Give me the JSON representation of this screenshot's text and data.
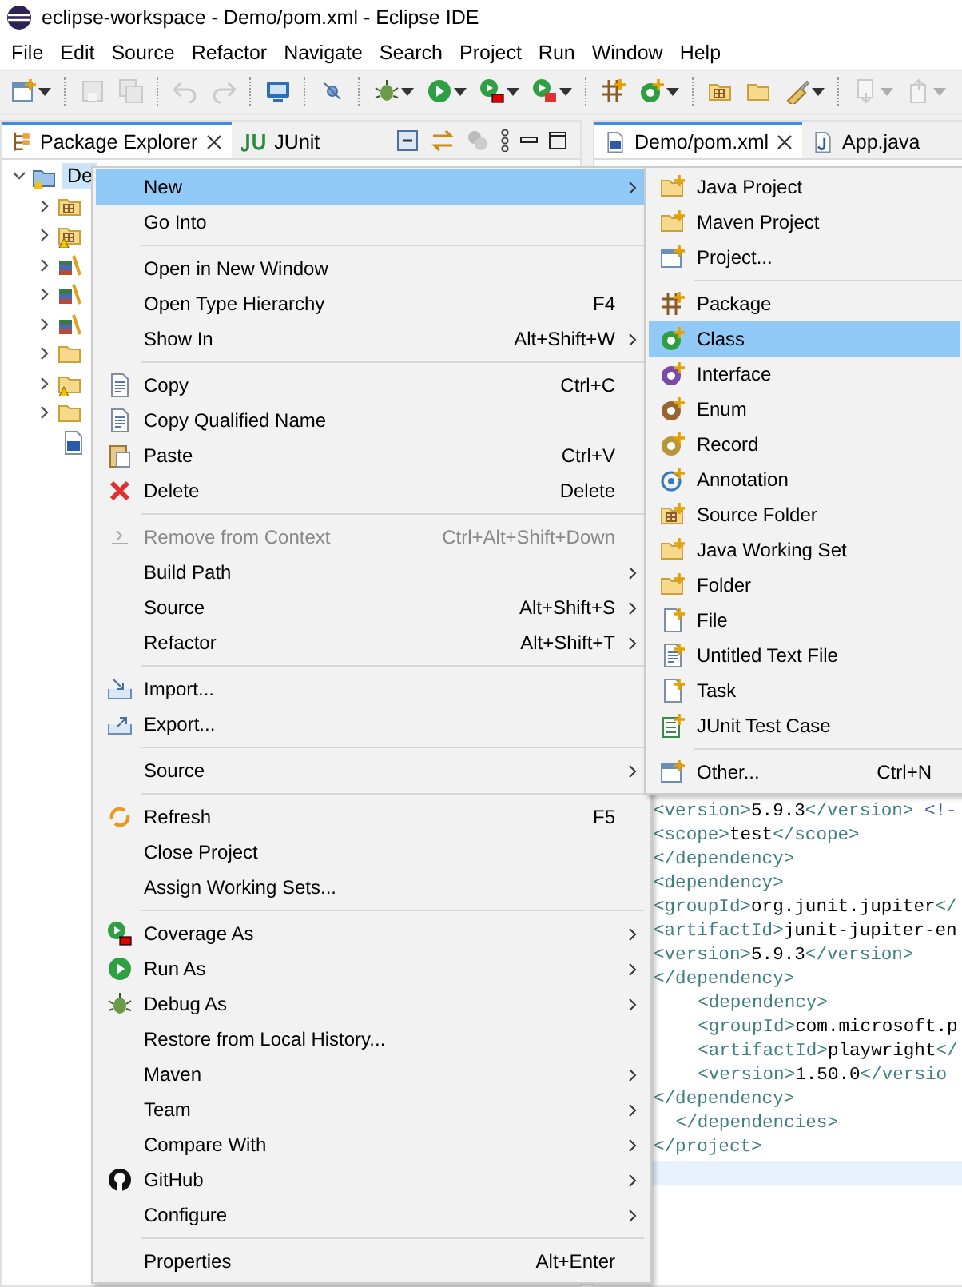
{
  "window": {
    "title": "eclipse-workspace - Demo/pom.xml - Eclipse IDE"
  },
  "menu_bar": [
    {
      "label": "File"
    },
    {
      "label": "Edit"
    },
    {
      "label": "Source"
    },
    {
      "label": "Refactor"
    },
    {
      "label": "Navigate"
    },
    {
      "label": "Search"
    },
    {
      "label": "Project"
    },
    {
      "label": "Run"
    },
    {
      "label": "Window"
    },
    {
      "label": "Help"
    }
  ],
  "toolbar": [
    {
      "disabled": false,
      "dropdown": true
    },
    {
      "disabled": true,
      "dropdown": false
    },
    {
      "disabled": true,
      "dropdown": false
    },
    {
      "disabled": true,
      "dropdown": false
    },
    {
      "disabled": true,
      "dropdown": false
    },
    {
      "disabled": false,
      "dropdown": false
    },
    {
      "disabled": false,
      "dropdown": false
    },
    {
      "disabled": false,
      "dropdown": true
    },
    {
      "disabled": false,
      "dropdown": true
    },
    {
      "disabled": false,
      "dropdown": true
    },
    {
      "disabled": false,
      "dropdown": true
    },
    {
      "disabled": false,
      "dropdown": false
    },
    {
      "disabled": false,
      "dropdown": true
    },
    {
      "disabled": false,
      "dropdown": false
    },
    {
      "disabled": false,
      "dropdown": false
    },
    {
      "disabled": false,
      "dropdown": true
    },
    {
      "disabled": true,
      "dropdown": true
    },
    {
      "disabled": true,
      "dropdown": true
    }
  ],
  "view_tabs": [
    {
      "label": "Package Explorer",
      "selected": true,
      "closable": true
    },
    {
      "label": "JUnit",
      "selected": false,
      "closable": false
    }
  ],
  "editor_tabs": [
    {
      "label": "Demo/pom.xml",
      "selected": true,
      "closable": true
    },
    {
      "label": "App.java",
      "selected": false,
      "closable": false
    }
  ],
  "tree": [
    {
      "label": "De",
      "expanded": true,
      "selected": true,
      "children": [
        {
          "kind": "source",
          "warning": false,
          "expanded": false
        },
        {
          "kind": "source",
          "warning": true,
          "expanded": false
        },
        {
          "kind": "library",
          "warning": false,
          "expanded": false
        },
        {
          "kind": "library",
          "warning": false,
          "expanded": false
        },
        {
          "kind": "library",
          "warning": false,
          "expanded": false
        },
        {
          "kind": "folder",
          "warning": false,
          "expanded": false
        },
        {
          "kind": "folder",
          "warning": true,
          "expanded": false
        },
        {
          "kind": "folder",
          "warning": false,
          "expanded": false
        },
        {
          "kind": "file"
        }
      ]
    }
  ],
  "code_lines": [
    {
      "kind": "plain",
      "tokens": [
        {
          "kind": "tag",
          "text": "<version>"
        },
        {
          "kind": "text",
          "text": "5.9.3"
        },
        {
          "kind": "tag",
          "text": "</version>"
        },
        {
          "kind": "comment",
          "text": " <!-"
        }
      ]
    },
    {
      "kind": "plain",
      "tokens": [
        {
          "kind": "tag",
          "text": "<scope>"
        },
        {
          "kind": "text",
          "text": "test"
        },
        {
          "kind": "tag",
          "text": "</scope>"
        }
      ]
    },
    {
      "kind": "plain",
      "tokens": [
        {
          "kind": "tag",
          "text": "</dependency>"
        }
      ]
    },
    {
      "kind": "plain",
      "tokens": [
        {
          "kind": "tag",
          "text": "<dependency>"
        }
      ]
    },
    {
      "kind": "plain",
      "tokens": [
        {
          "kind": "tag",
          "text": "<groupId>"
        },
        {
          "kind": "text",
          "text": "org.junit.jupiter"
        },
        {
          "kind": "tag",
          "text": "</"
        }
      ]
    },
    {
      "kind": "plain",
      "tokens": [
        {
          "kind": "tag",
          "text": "<artifactId>"
        },
        {
          "kind": "text",
          "text": "junit-jupiter-en"
        }
      ]
    },
    {
      "kind": "plain",
      "tokens": [
        {
          "kind": "tag",
          "text": "<version>"
        },
        {
          "kind": "text",
          "text": "5.9.3"
        },
        {
          "kind": "tag",
          "text": "</version>"
        }
      ]
    },
    {
      "kind": "plain",
      "tokens": [
        {
          "kind": "tag",
          "text": "</dependency>"
        }
      ]
    },
    {
      "kind": "indented",
      "tokens": [
        {
          "kind": "tag",
          "text": "<dependency>"
        }
      ]
    },
    {
      "kind": "indented",
      "tokens": [
        {
          "kind": "tag",
          "text": "<groupId>"
        },
        {
          "kind": "text",
          "text": "com.microsoft.p"
        }
      ]
    },
    {
      "kind": "indented",
      "tokens": [
        {
          "kind": "tag",
          "text": "<artifactId>"
        },
        {
          "kind": "text",
          "text": "playwright"
        },
        {
          "kind": "tag",
          "text": "</"
        }
      ]
    },
    {
      "kind": "indented",
      "tokens": [
        {
          "kind": "tag",
          "text": "<version>"
        },
        {
          "kind": "text",
          "text": "1.50.0"
        },
        {
          "kind": "tag",
          "text": "</versio"
        }
      ]
    },
    {
      "kind": "plain",
      "tokens": [
        {
          "kind": "tag",
          "text": "</dependency>"
        }
      ]
    },
    {
      "kind": "half-indented",
      "tokens": [
        {
          "kind": "tag",
          "text": "</dependencies>"
        }
      ]
    },
    {
      "kind": "plain",
      "tokens": [
        {
          "kind": "tag",
          "text": "</project>"
        }
      ]
    },
    {
      "kind": "current"
    }
  ],
  "context_menu": [
    {
      "kind": "item",
      "label": "New",
      "submenu": true,
      "selected": true,
      "disabled": false
    },
    {
      "kind": "item",
      "label": "Go Into",
      "submenu": false,
      "selected": false,
      "disabled": false
    },
    {
      "kind": "separator"
    },
    {
      "kind": "item",
      "label": "Open in New Window",
      "submenu": false,
      "selected": false,
      "disabled": false
    },
    {
      "kind": "item",
      "label": "Open Type Hierarchy",
      "shortcut": "F4",
      "submenu": false,
      "selected": false,
      "disabled": false
    },
    {
      "kind": "item",
      "label": "Show In",
      "shortcut": "Alt+Shift+W",
      "submenu": true,
      "selected": false,
      "disabled": false
    },
    {
      "kind": "separator"
    },
    {
      "kind": "item",
      "label": "Copy",
      "shortcut": "Ctrl+C",
      "submenu": false,
      "selected": false,
      "disabled": false
    },
    {
      "kind": "item",
      "label": "Copy Qualified Name",
      "submenu": false,
      "selected": false,
      "disabled": false
    },
    {
      "kind": "item",
      "label": "Paste",
      "shortcut": "Ctrl+V",
      "submenu": false,
      "selected": false,
      "disabled": false
    },
    {
      "kind": "item",
      "label": "Delete",
      "shortcut": "Delete",
      "submenu": false,
      "selected": false,
      "disabled": false
    },
    {
      "kind": "separator"
    },
    {
      "kind": "item",
      "label": "Remove from Context",
      "shortcut": "Ctrl+Alt+Shift+Down",
      "submenu": false,
      "selected": false,
      "disabled": true
    },
    {
      "kind": "item",
      "label": "Build Path",
      "submenu": true,
      "selected": false,
      "disabled": false
    },
    {
      "kind": "item",
      "label": "Source",
      "shortcut": "Alt+Shift+S",
      "submenu": true,
      "selected": false,
      "disabled": false
    },
    {
      "kind": "item",
      "label": "Refactor",
      "shortcut": "Alt+Shift+T",
      "submenu": true,
      "selected": false,
      "disabled": false
    },
    {
      "kind": "separator"
    },
    {
      "kind": "item",
      "label": "Import...",
      "submenu": false,
      "selected": false,
      "disabled": false
    },
    {
      "kind": "item",
      "label": "Export...",
      "submenu": false,
      "selected": false,
      "disabled": false
    },
    {
      "kind": "separator"
    },
    {
      "kind": "item",
      "label": "Source",
      "submenu": true,
      "selected": false,
      "disabled": false
    },
    {
      "kind": "separator"
    },
    {
      "kind": "item",
      "label": "Refresh",
      "shortcut": "F5",
      "submenu": false,
      "selected": false,
      "disabled": false
    },
    {
      "kind": "item",
      "label": "Close Project",
      "submenu": false,
      "selected": false,
      "disabled": false
    },
    {
      "kind": "item",
      "label": "Assign Working Sets...",
      "submenu": false,
      "selected": false,
      "disabled": false
    },
    {
      "kind": "separator"
    },
    {
      "kind": "item",
      "label": "Coverage As",
      "submenu": true,
      "selected": false,
      "disabled": false
    },
    {
      "kind": "item",
      "label": "Run As",
      "submenu": true,
      "selected": false,
      "disabled": false
    },
    {
      "kind": "item",
      "label": "Debug As",
      "submenu": true,
      "selected": false,
      "disabled": false
    },
    {
      "kind": "item",
      "label": "Restore from Local History...",
      "submenu": false,
      "selected": false,
      "disabled": false
    },
    {
      "kind": "item",
      "label": "Maven",
      "submenu": true,
      "selected": false,
      "disabled": false
    },
    {
      "kind": "item",
      "label": "Team",
      "submenu": true,
      "selected": false,
      "disabled": false
    },
    {
      "kind": "item",
      "label": "Compare With",
      "submenu": true,
      "selected": false,
      "disabled": false
    },
    {
      "kind": "item",
      "label": "GitHub",
      "submenu": true,
      "selected": false,
      "disabled": false
    },
    {
      "kind": "item",
      "label": "Configure",
      "submenu": true,
      "selected": false,
      "disabled": false
    },
    {
      "kind": "separator"
    },
    {
      "kind": "item",
      "label": "Properties",
      "shortcut": "Alt+Enter",
      "submenu": false,
      "selected": false,
      "disabled": false
    }
  ],
  "new_submenu": [
    {
      "kind": "item",
      "label": "Java Project",
      "selected": false
    },
    {
      "kind": "item",
      "label": "Maven Project",
      "selected": false
    },
    {
      "kind": "item",
      "label": "Project...",
      "selected": false
    },
    {
      "kind": "separator"
    },
    {
      "kind": "item",
      "label": "Package",
      "selected": false
    },
    {
      "kind": "item",
      "label": "Class",
      "selected": true
    },
    {
      "kind": "item",
      "label": "Interface",
      "selected": false
    },
    {
      "kind": "item",
      "label": "Enum",
      "selected": false
    },
    {
      "kind": "item",
      "label": "Record",
      "selected": false
    },
    {
      "kind": "item",
      "label": "Annotation",
      "selected": false
    },
    {
      "kind": "item",
      "label": "Source Folder",
      "selected": false
    },
    {
      "kind": "item",
      "label": "Java Working Set",
      "selected": false
    },
    {
      "kind": "item",
      "label": "Folder",
      "selected": false
    },
    {
      "kind": "item",
      "label": "File",
      "selected": false
    },
    {
      "kind": "item",
      "label": "Untitled Text File",
      "selected": false
    },
    {
      "kind": "item",
      "label": "Task",
      "selected": false
    },
    {
      "kind": "item",
      "label": "JUnit Test Case",
      "selected": false
    },
    {
      "kind": "separator"
    },
    {
      "kind": "item",
      "label": "Other...",
      "shortcut": "Ctrl+N",
      "selected": false
    }
  ]
}
